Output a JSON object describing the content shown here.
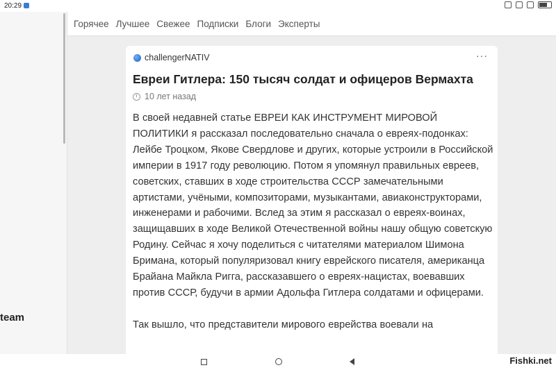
{
  "status": {
    "time": "20:29"
  },
  "sidebar": {
    "partial_label": "team"
  },
  "nav": {
    "items": [
      "Горячее",
      "Лучшее",
      "Свежее",
      "Подписки",
      "Блоги",
      "Эксперты"
    ]
  },
  "article": {
    "author": "challengerNATIV",
    "more": "···",
    "title": "Евреи Гитлера: 150 тысяч солдат и офицеров Вермахта",
    "time_ago": "10 лет назад",
    "paragraph1": "В своей недавней статье ЕВРЕИ КАК ИНСТРУМЕНТ МИРОВОЙ ПОЛИТИКИ я рассказал последовательно сначала о евреях-подонках: Лейбе Троцком, Якове Свердлове и других, которые устроили в Российской империи в 1917 году революцию. Потом я упомянул правильных евреев, советских, ставших в ходе строительства СССР замечательными артистами, учёными, композиторами, музыкантами, авиаконструкторами, инженерами и рабочими. Вслед за этим я рассказал о евреях-воинах, защищавших в ходе Великой Отечественной войны нашу общую советскую Родину. Сейчас я хочу поделиться с читателями материалом Шимона Бримана, который популяризовал книгу еврейского писателя, американца Брайана Майкла Ригга, рассказавшего о евреях-нацистах, воевавших против СССР, будучи в армии Адольфа Гитлера солдатами и офицерами.",
    "paragraph2": "Так вышло, что представители мирового еврейства воевали на"
  },
  "watermark": "Fishki.net"
}
